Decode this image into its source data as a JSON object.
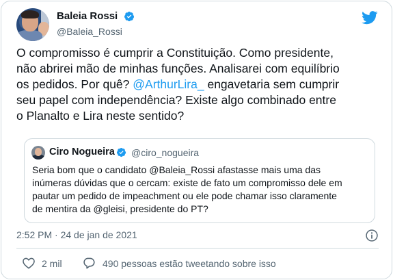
{
  "tweet": {
    "author_name": "Baleia Rossi",
    "author_handle": "@Baleia_Rossi",
    "text_lines": [
      [
        "O compromisso é cumprir a Constituição. Como presidente,",
        "",
        ""
      ],
      [
        "não abrirei mão de minhas funções. Analisarei com equilíbrio",
        "",
        ""
      ],
      [
        "os pedidos. Por quê? ",
        "@ArthurLira_",
        " engavetaria sem cumprir"
      ],
      [
        "seu papel com independência? Existe algo combinado entre",
        "",
        ""
      ],
      [
        "o Planalto e Lira neste sentido?",
        "",
        ""
      ]
    ],
    "timestamp": "2:52 PM · 24 de jan de 2021",
    "like_count": "2 mil",
    "reply_text": "490 pessoas estão tweetando sobre isso"
  },
  "quoted": {
    "author_name": "Ciro Nogueira",
    "author_handle": "@ciro_nogueira",
    "text_lines": [
      "Seria bom que o candidato @Baleia_Rossi afastasse mais uma das",
      "inúmeras dúvidas que o cercam: existe de fato um compromisso dele em",
      "pautar um pedido de impeachment ou ele pode chamar isso claramente",
      "de mentira da @gleisi, presidente do PT?"
    ]
  },
  "colors": {
    "accent": "#1d9bf0",
    "secondary_text": "#536471",
    "border": "#cfd9de"
  },
  "icons": [
    "verified-badge-icon",
    "twitter-bird-icon",
    "info-icon",
    "heart-icon",
    "reply-icon"
  ]
}
